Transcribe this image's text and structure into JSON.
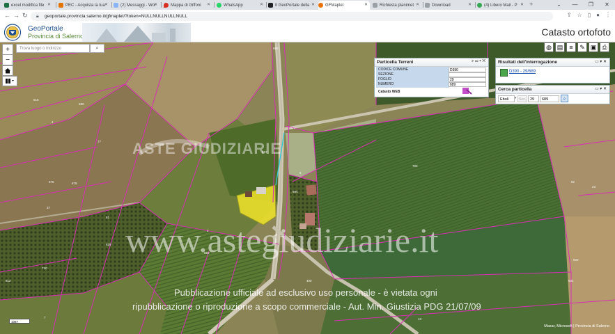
{
  "browser": {
    "tabs": [
      {
        "label": "excel modifica file",
        "color": "#1e7145"
      },
      {
        "label": "PEC - Acquista la tua",
        "color": "#e37400"
      },
      {
        "label": "(2) Messaggi - Wor",
        "color": "#5f6368"
      },
      {
        "label": "Mappa di Giffoni",
        "color": "#d93025"
      },
      {
        "label": "WhatsApp",
        "color": "#25d366"
      },
      {
        "label": "Il GeoPortale della",
        "color": "#202124"
      },
      {
        "label": "GFMaplet",
        "color": "#e8710a"
      },
      {
        "label": "Richiesta planimet",
        "color": "#5f6368"
      },
      {
        "label": "Download",
        "color": "#5f6368"
      },
      {
        "label": "(4) Libero Mail - P",
        "color": "#34a853"
      }
    ],
    "active_tab": 6,
    "url": "geoportale.provincia.salerno.it/gfmaplet/?token=NULLNULLNULLNULL"
  },
  "header": {
    "brand_line1": "GeoPortale",
    "brand_line2": "Provincia di Salerno",
    "page_title": "Catasto ortofoto"
  },
  "map": {
    "search_placeholder": "Trova luogo o indirizzo",
    "scale_label": "1057",
    "attribution": "Maxar, Microsoft | Provincia di Salerno",
    "parcel_labels": [
      "689",
      "5",
      "680",
      "4",
      "2",
      "672",
      "23",
      "790",
      "694",
      "657",
      "616",
      "675",
      "678",
      "37",
      "81",
      "710",
      "629",
      "650",
      "82",
      "600",
      "601",
      "612",
      "400",
      "7",
      "77",
      "19",
      "13"
    ],
    "watermark_logo": "ASTE GIUDIZIARIE",
    "watermark_url": "www.astegiudiziarie.it",
    "disclaimer_line1": "Pubblicazione ufficiale ad esclusivo uso personale - è vietata ogni",
    "disclaimer_line2": "ripubblicazione o riproduzione a scopo commerciale - Aut. Min. Giustizia PDG 21/07/09"
  },
  "particella_panel": {
    "title": "Particella Terreni",
    "rows": [
      {
        "label": "CODICE COMUNE",
        "value": "D390"
      },
      {
        "label": "SEZIONE",
        "value": ""
      },
      {
        "label": "FOGLIO",
        "value": "29"
      },
      {
        "label": "NUMERO",
        "value": "689"
      }
    ],
    "cadastre_label": "Catasto WEB"
  },
  "results_panel": {
    "title": "Risultati dell'interrogazione",
    "result_link": "D390 - 29/689"
  },
  "cerca_panel": {
    "title": "Cerca particella",
    "comune": "Eboli",
    "sezione": "Sez.",
    "foglio": "29",
    "numero": "689"
  }
}
